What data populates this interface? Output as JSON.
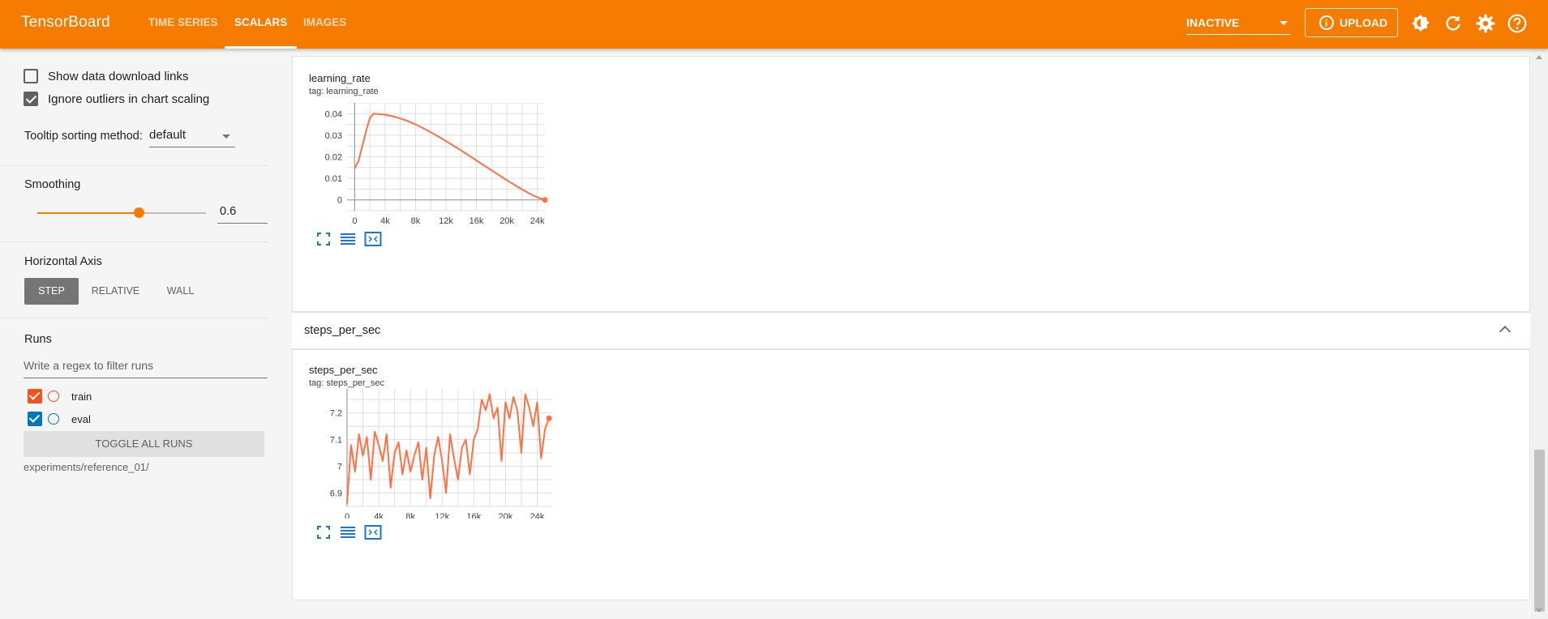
{
  "app": {
    "title": "TensorBoard"
  },
  "nav": {
    "tabs": [
      {
        "label": "Time Series",
        "active": false
      },
      {
        "label": "Scalars",
        "active": true
      },
      {
        "label": "Images",
        "active": false
      }
    ]
  },
  "header": {
    "status": "INACTIVE",
    "upload_label": "UPLOAD"
  },
  "colors": {
    "accent": "#f57c00",
    "train": "#f4511e",
    "eval": "#0077bb",
    "chart_line": "#ff7043"
  },
  "sidebar": {
    "show_download_links": {
      "label": "Show data download links",
      "checked": false
    },
    "ignore_outliers": {
      "label": "Ignore outliers in chart scaling",
      "checked": true
    },
    "tooltip_label": "Tooltip sorting method:",
    "tooltip_value": "default",
    "smoothing_label": "Smoothing",
    "smoothing_value": "0.6",
    "smoothing_fraction": 0.6,
    "horizontal_axis_label": "Horizontal Axis",
    "axis_options": [
      {
        "label": "Step",
        "active": true
      },
      {
        "label": "Relative",
        "active": false
      },
      {
        "label": "Wall",
        "active": false
      }
    ],
    "runs_label": "Runs",
    "filter_placeholder": "Write a regex to filter runs",
    "runs": [
      {
        "name": "train",
        "checked": true
      },
      {
        "name": "eval",
        "checked": true
      }
    ],
    "toggle_all_label": "Toggle all runs",
    "logdir": "experiments/reference_01/"
  },
  "main": {
    "cards": [
      {
        "title": "learning_rate",
        "tag": "tag: learning_rate"
      },
      {
        "group": "steps_per_sec",
        "title": "steps_per_sec",
        "tag": "tag: steps_per_sec"
      }
    ]
  },
  "chart_data": [
    {
      "type": "line",
      "title": "learning_rate",
      "xlim": [
        -1000,
        25000
      ],
      "ylim": [
        -0.005,
        0.045
      ],
      "xticks": [
        0,
        4000,
        8000,
        12000,
        16000,
        20000,
        24000
      ],
      "xtick_labels": [
        "0",
        "4k",
        "8k",
        "12k",
        "16k",
        "20k",
        "24k"
      ],
      "yticks": [
        0,
        0.01,
        0.02,
        0.03,
        0.04
      ],
      "ytick_labels": [
        "0",
        "0.01",
        "0.02",
        "0.03",
        "0.04"
      ],
      "grid": true,
      "series": [
        {
          "x": [
            0,
            500,
            1000,
            1500,
            2000,
            2500,
            3000,
            4000,
            5000,
            6000,
            7000,
            8000,
            9000,
            10000,
            11000,
            12000,
            13000,
            14000,
            15000,
            16000,
            17000,
            18000,
            19000,
            20000,
            21000,
            22000,
            23000,
            24000,
            25000
          ],
          "y": [
            0.0145,
            0.018,
            0.025,
            0.032,
            0.038,
            0.04,
            0.0399,
            0.0395,
            0.0388,
            0.0378,
            0.0365,
            0.035,
            0.0333,
            0.0314,
            0.0294,
            0.0273,
            0.0251,
            0.0229,
            0.0206,
            0.0183,
            0.016,
            0.0137,
            0.0114,
            0.0091,
            0.0069,
            0.0049,
            0.0029,
            0.0012,
            0.0
          ]
        }
      ]
    },
    {
      "type": "line",
      "title": "steps_per_sec",
      "xlim": [
        0,
        26000
      ],
      "ylim": [
        6.85,
        7.29
      ],
      "xticks": [
        0,
        4000,
        8000,
        12000,
        16000,
        20000,
        24000
      ],
      "xtick_labels": [
        "0",
        "4k",
        "8k",
        "12k",
        "16k",
        "20k",
        "24k"
      ],
      "yticks": [
        6.9,
        7.0,
        7.1,
        7.2
      ],
      "ytick_labels": [
        "6.9",
        "7",
        "7.1",
        "7.2"
      ],
      "grid": true,
      "series": [
        {
          "x": [
            0,
            500,
            1000,
            1500,
            2000,
            2500,
            3000,
            3500,
            4000,
            4500,
            5000,
            5500,
            6000,
            6500,
            7000,
            7500,
            8000,
            8500,
            9000,
            9500,
            10000,
            10500,
            11000,
            11500,
            12000,
            12500,
            13000,
            13500,
            14000,
            14500,
            15000,
            15500,
            16000,
            16500,
            17000,
            17500,
            18000,
            18500,
            19000,
            19500,
            20000,
            20500,
            21000,
            21500,
            22000,
            22500,
            23000,
            23500,
            24000,
            24500,
            25000,
            25500
          ],
          "y": [
            6.86,
            7.08,
            6.98,
            7.12,
            7.04,
            7.11,
            6.95,
            7.13,
            7.08,
            7.02,
            7.12,
            6.92,
            7.05,
            7.09,
            6.97,
            7.06,
            6.98,
            7.04,
            7.09,
            6.95,
            7.07,
            6.88,
            7.04,
            7.11,
            7.02,
            6.9,
            7.12,
            7.03,
            6.95,
            7.07,
            7.1,
            6.97,
            7.1,
            7.14,
            7.25,
            7.21,
            7.27,
            7.18,
            7.22,
            7.02,
            7.24,
            7.18,
            7.26,
            7.21,
            7.05,
            7.27,
            7.22,
            7.15,
            7.24,
            7.03,
            7.14,
            7.18
          ]
        }
      ]
    }
  ]
}
